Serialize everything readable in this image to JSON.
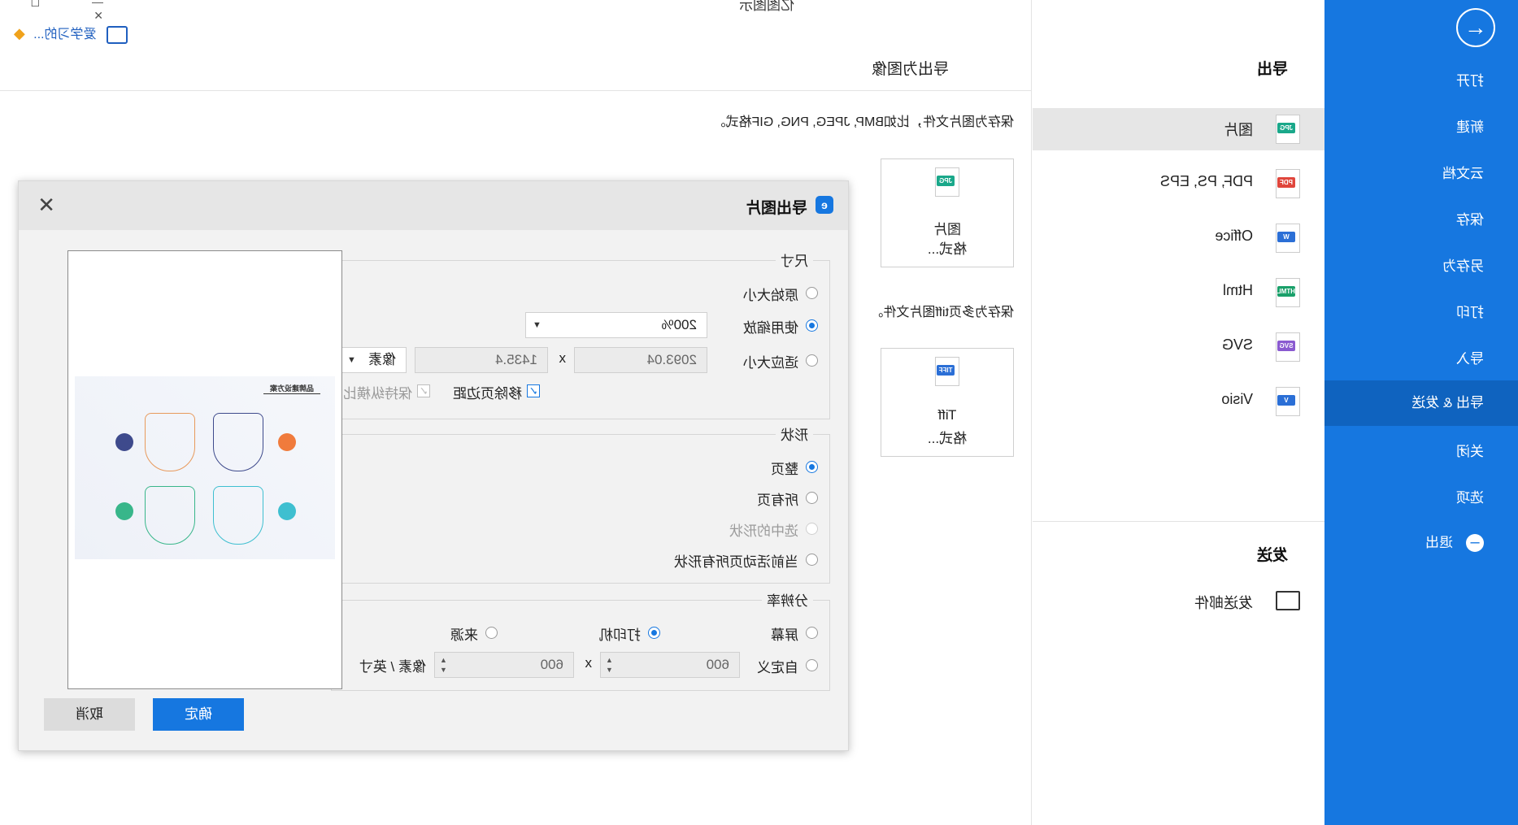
{
  "app": {
    "title": "亿图图示",
    "user": "爱学习的..."
  },
  "nav": {
    "items": [
      "打开",
      "新建",
      "云文档",
      "保存",
      "另存为",
      "打印",
      "导入",
      "导出 & 发送",
      "关闭",
      "选项",
      "退出"
    ],
    "active": "导出 & 发送"
  },
  "export_section": {
    "title": "导出",
    "items": [
      {
        "label": "图片",
        "icon": "JPG",
        "color": "#1aa88a"
      },
      {
        "label": "PDF, PS, EPS",
        "icon": "PDF",
        "color": "#e0463c"
      },
      {
        "label": "Office",
        "icon": "W",
        "color": "#2b6fd6"
      },
      {
        "label": "Html",
        "icon": "HTML",
        "color": "#1aa06a"
      },
      {
        "label": "SVG",
        "icon": "SVG",
        "color": "#8a5ad0"
      },
      {
        "label": "Visio",
        "icon": "V",
        "color": "#2b6fd6"
      }
    ]
  },
  "send_section": {
    "title": "发送",
    "items": [
      {
        "label": "发送邮件"
      }
    ]
  },
  "content": {
    "heading": "导出为图像",
    "desc1": "保存为图片文件，比如BMP, JPEG, PNG, GIF格式。",
    "card1": {
      "line1": "图片",
      "line2": "格式...",
      "icon": "JPG"
    },
    "desc2": "保存为多页tiff图片文件。",
    "card2": {
      "line1": "Tiff",
      "line2": "格式...",
      "icon": "TIFF"
    }
  },
  "dialog": {
    "title": "导出图片",
    "size": {
      "legend": "尺寸",
      "original": "原始大小",
      "use_zoom": "使用缩放",
      "zoom_value": "200%",
      "fit_size": "适应大小",
      "width": "2093.04",
      "x": "x",
      "height": "1435.4",
      "unit": "像素",
      "remove_margin": "移除页边距",
      "keep_ratio": "保持纵横比"
    },
    "shape": {
      "legend": "形状",
      "whole_page": "整页",
      "all_pages": "所有页",
      "selected": "选中的形状",
      "active_page_all": "当前活动页所有形状"
    },
    "resolution": {
      "legend": "分辨率",
      "screen": "屏幕",
      "printer": "打印机",
      "source": "来源",
      "custom": "自定义",
      "w": "600",
      "x": "x",
      "h": "600",
      "unit": "像素 / 英寸"
    },
    "ok": "确定",
    "cancel": "取消",
    "preview_title": "品牌建设方案"
  }
}
